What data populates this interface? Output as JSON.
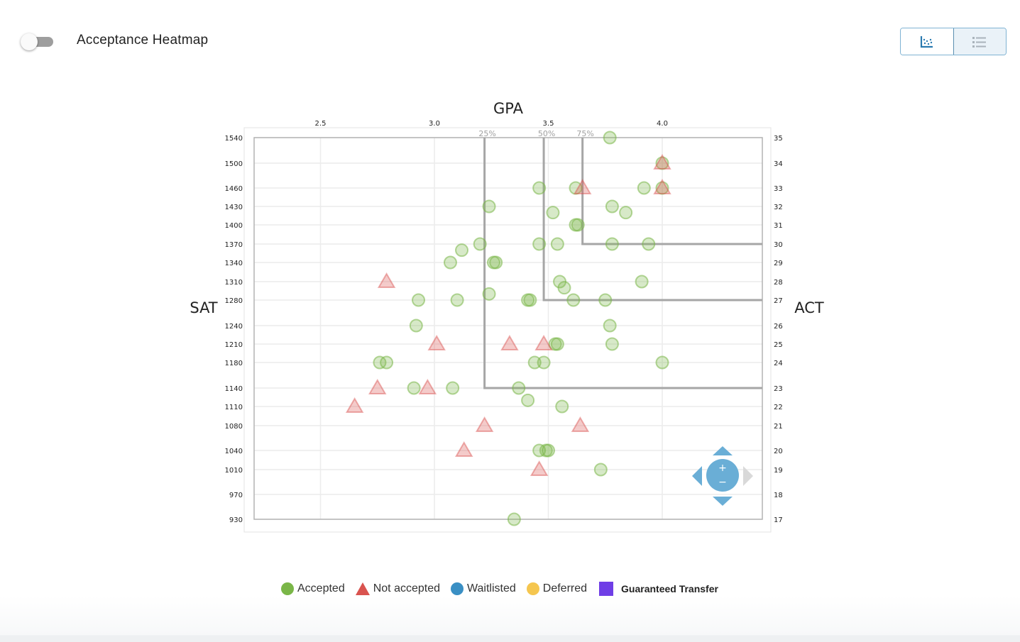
{
  "header": {
    "toggle_label": "Acceptance Heatmap",
    "toggle_on": false,
    "view_buttons": [
      {
        "name": "scatter-view",
        "icon": "scatter-plot-icon",
        "active": true
      },
      {
        "name": "list-view",
        "icon": "list-icon",
        "active": false
      }
    ]
  },
  "colors": {
    "accepted": "#7ab648",
    "not_accepted": "#d9534f",
    "waitlisted": "#3a8fc4",
    "deferred": "#f5c64f",
    "guaranteed_transfer": "#6f3ee6",
    "percentile_line": "#a6a6a6",
    "nav_control": "#6aaed6"
  },
  "legend": [
    {
      "key": "accepted",
      "label": "Accepted",
      "shape": "circle"
    },
    {
      "key": "not_accepted",
      "label": "Not accepted",
      "shape": "triangle"
    },
    {
      "key": "waitlisted",
      "label": "Waitlisted",
      "shape": "circle"
    },
    {
      "key": "deferred",
      "label": "Deferred",
      "shape": "circle"
    },
    {
      "key": "guaranteed_transfer",
      "label": "Guaranteed Transfer",
      "shape": "square"
    }
  ],
  "navigator": {
    "zoom_in": "+",
    "zoom_out": "−"
  },
  "chart_data": {
    "type": "scatter",
    "title": "",
    "xlabel": "GPA",
    "ylabel_left": "SAT",
    "ylabel_right": "ACT",
    "x_ticks": [
      "2.5",
      "3.0",
      "3.5",
      "4.0"
    ],
    "x_tick_values": [
      2.5,
      3.0,
      3.5,
      4.0
    ],
    "xlim": [
      2.21,
      4.44
    ],
    "sat_ticks": [
      1540,
      1500,
      1460,
      1430,
      1400,
      1370,
      1340,
      1310,
      1280,
      1240,
      1210,
      1180,
      1140,
      1110,
      1080,
      1040,
      1010,
      970,
      930
    ],
    "act_ticks": [
      35,
      34,
      33,
      32,
      31,
      30,
      29,
      28,
      27,
      26,
      25,
      24,
      23,
      22,
      21,
      20,
      19,
      18,
      17
    ],
    "grid": true,
    "percentiles": [
      {
        "label": "25%",
        "gpa": 3.22,
        "sat": 1140
      },
      {
        "label": "50%",
        "gpa": 3.48,
        "sat": 1280
      },
      {
        "label": "75%",
        "gpa": 3.65,
        "sat": 1370
      }
    ],
    "series": [
      {
        "name": "Accepted",
        "key": "accepted",
        "points": [
          {
            "gpa": 3.77,
            "sat": 1540
          },
          {
            "gpa": 4.0,
            "sat": 1500
          },
          {
            "gpa": 3.46,
            "sat": 1460
          },
          {
            "gpa": 3.62,
            "sat": 1460
          },
          {
            "gpa": 3.92,
            "sat": 1460
          },
          {
            "gpa": 4.0,
            "sat": 1460
          },
          {
            "gpa": 3.24,
            "sat": 1430
          },
          {
            "gpa": 3.52,
            "sat": 1420
          },
          {
            "gpa": 3.78,
            "sat": 1430
          },
          {
            "gpa": 3.84,
            "sat": 1420
          },
          {
            "gpa": 3.62,
            "sat": 1400
          },
          {
            "gpa": 3.63,
            "sat": 1400
          },
          {
            "gpa": 3.2,
            "sat": 1370
          },
          {
            "gpa": 3.12,
            "sat": 1360
          },
          {
            "gpa": 3.46,
            "sat": 1370
          },
          {
            "gpa": 3.54,
            "sat": 1370
          },
          {
            "gpa": 3.78,
            "sat": 1370
          },
          {
            "gpa": 3.94,
            "sat": 1370
          },
          {
            "gpa": 3.07,
            "sat": 1340
          },
          {
            "gpa": 3.26,
            "sat": 1340
          },
          {
            "gpa": 3.27,
            "sat": 1340
          },
          {
            "gpa": 3.55,
            "sat": 1310
          },
          {
            "gpa": 3.57,
            "sat": 1300
          },
          {
            "gpa": 3.91,
            "sat": 1310
          },
          {
            "gpa": 3.24,
            "sat": 1290
          },
          {
            "gpa": 2.93,
            "sat": 1280
          },
          {
            "gpa": 3.1,
            "sat": 1280
          },
          {
            "gpa": 3.41,
            "sat": 1280
          },
          {
            "gpa": 3.42,
            "sat": 1280
          },
          {
            "gpa": 3.61,
            "sat": 1280
          },
          {
            "gpa": 3.75,
            "sat": 1280
          },
          {
            "gpa": 2.92,
            "sat": 1240
          },
          {
            "gpa": 3.77,
            "sat": 1240
          },
          {
            "gpa": 3.53,
            "sat": 1210
          },
          {
            "gpa": 3.54,
            "sat": 1210
          },
          {
            "gpa": 3.78,
            "sat": 1210
          },
          {
            "gpa": 2.76,
            "sat": 1180
          },
          {
            "gpa": 2.79,
            "sat": 1180
          },
          {
            "gpa": 3.44,
            "sat": 1180
          },
          {
            "gpa": 3.48,
            "sat": 1180
          },
          {
            "gpa": 4.0,
            "sat": 1180
          },
          {
            "gpa": 2.91,
            "sat": 1140
          },
          {
            "gpa": 3.08,
            "sat": 1140
          },
          {
            "gpa": 3.37,
            "sat": 1140
          },
          {
            "gpa": 3.41,
            "sat": 1120
          },
          {
            "gpa": 3.56,
            "sat": 1110
          },
          {
            "gpa": 3.46,
            "sat": 1040
          },
          {
            "gpa": 3.49,
            "sat": 1040
          },
          {
            "gpa": 3.5,
            "sat": 1040
          },
          {
            "gpa": 3.73,
            "sat": 1010
          },
          {
            "gpa": 3.35,
            "sat": 930
          }
        ]
      },
      {
        "name": "Not accepted",
        "key": "not_accepted",
        "points": [
          {
            "gpa": 4.0,
            "sat": 1500
          },
          {
            "gpa": 3.65,
            "sat": 1460
          },
          {
            "gpa": 4.0,
            "sat": 1460
          },
          {
            "gpa": 2.79,
            "sat": 1310
          },
          {
            "gpa": 3.01,
            "sat": 1210
          },
          {
            "gpa": 3.33,
            "sat": 1210
          },
          {
            "gpa": 3.48,
            "sat": 1210
          },
          {
            "gpa": 2.75,
            "sat": 1140
          },
          {
            "gpa": 2.97,
            "sat": 1140
          },
          {
            "gpa": 2.65,
            "sat": 1110
          },
          {
            "gpa": 3.22,
            "sat": 1080
          },
          {
            "gpa": 3.64,
            "sat": 1080
          },
          {
            "gpa": 3.13,
            "sat": 1040
          },
          {
            "gpa": 3.46,
            "sat": 1010
          }
        ]
      }
    ]
  }
}
